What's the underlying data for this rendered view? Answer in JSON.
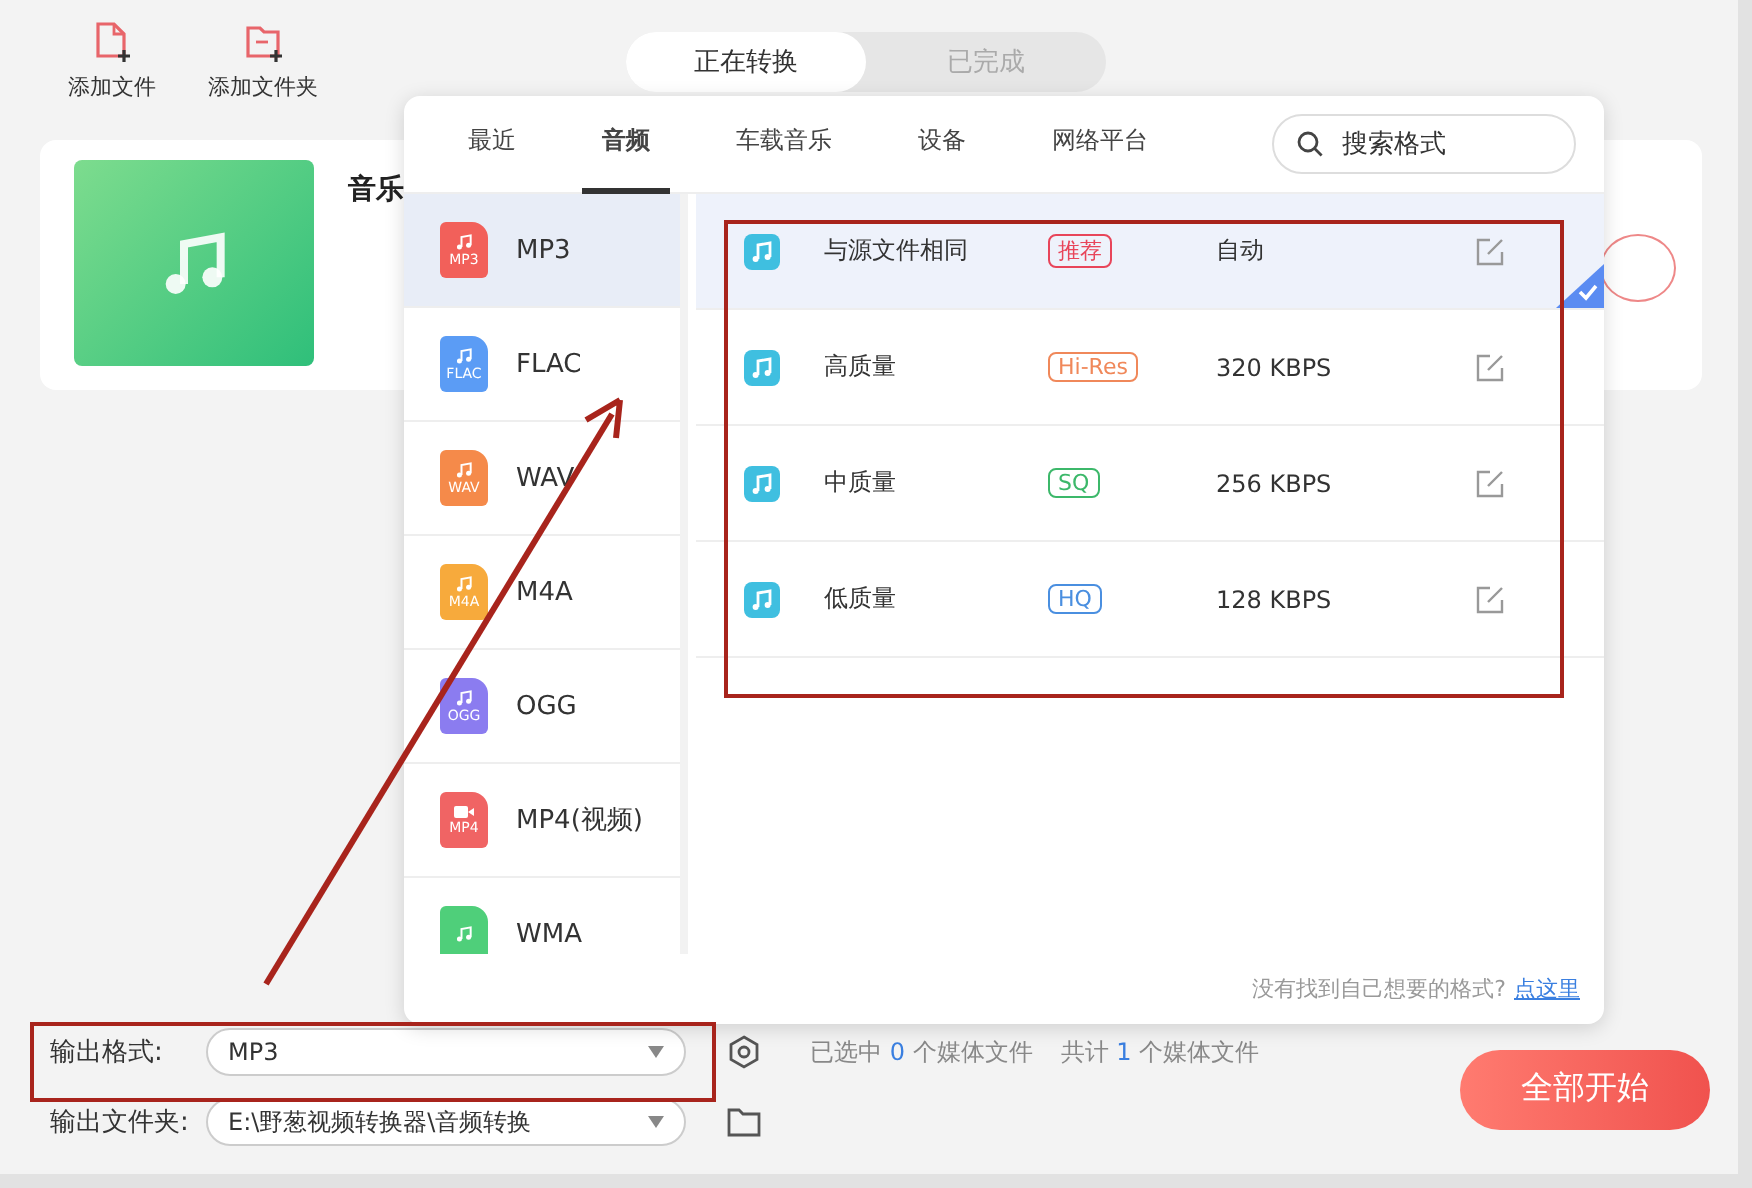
{
  "toolbar": [
    {
      "label": "添加文件",
      "kind": "file"
    },
    {
      "label": "添加文件夹",
      "kind": "folder"
    }
  ],
  "view_tabs": [
    {
      "label": "正在转换",
      "selected": true
    },
    {
      "label": "已完成",
      "selected": false
    }
  ],
  "file_card": {
    "title": "音乐"
  },
  "format_popup": {
    "tabs": [
      {
        "label": "最近",
        "selected": false
      },
      {
        "label": "音频",
        "selected": true
      },
      {
        "label": "车载音乐",
        "selected": false
      },
      {
        "label": "设备",
        "selected": false
      },
      {
        "label": "网络平台",
        "selected": false
      }
    ],
    "search": {
      "placeholder": "搜索格式"
    },
    "formats": [
      {
        "name": "MP3",
        "icon_label": "MP3",
        "kind": "audio",
        "color": "#f2605a",
        "selected": true
      },
      {
        "name": "FLAC",
        "icon_label": "FLAC",
        "kind": "audio",
        "color": "#5b9cf5",
        "selected": false
      },
      {
        "name": "WAV",
        "icon_label": "WAV",
        "kind": "audio",
        "color": "#f58a4a",
        "selected": false
      },
      {
        "name": "M4A",
        "icon_label": "M4A",
        "kind": "audio",
        "color": "#f7aa3c",
        "selected": false
      },
      {
        "name": "OGG",
        "icon_label": "OGG",
        "kind": "audio",
        "color": "#8b7cf0",
        "selected": false
      },
      {
        "name": "MP4(视频)",
        "icon_label": "MP4",
        "kind": "video",
        "color": "#f06464",
        "selected": false
      },
      {
        "name": "WMA",
        "kind": "audio",
        "color": "#4fcf7a",
        "selected": false
      }
    ],
    "qualities": [
      {
        "name": "与源文件相同",
        "tag": "推荐",
        "color": "#e8455a",
        "bitrate": "自动",
        "selected": true
      },
      {
        "name": "高质量",
        "tag": "Hi-Res",
        "color": "#f0885a",
        "bitrate": "320 KBPS",
        "selected": false
      },
      {
        "name": "中质量",
        "tag": "SQ",
        "color": "#3cb86a",
        "bitrate": "256 KBPS",
        "selected": false
      },
      {
        "name": "低质量",
        "tag": "HQ",
        "color": "#4a8fe0",
        "bitrate": "128 KBPS",
        "selected": false
      }
    ],
    "hint": "没有找到自己想要的格式?",
    "hint_link": "点这里"
  },
  "output_format": {
    "label": "输出格式:",
    "value": "MP3"
  },
  "output_folder": {
    "label": "输出文件夹:",
    "value": "E:\\野葱视频转换器\\音频转换"
  },
  "selected_status": {
    "prefix": "已选中",
    "count": "0",
    "suffix": "个媒体文件"
  },
  "total_status": {
    "prefix": "共计",
    "count": "1",
    "suffix": "个媒体文件"
  },
  "start_button": "全部开始"
}
